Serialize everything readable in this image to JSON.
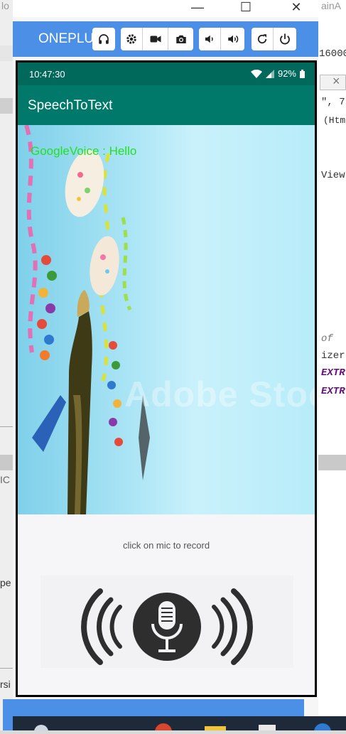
{
  "background": {
    "fragments": [
      "lo",
      "ainA",
      "16000",
      "\", 7",
      "(Htm",
      "View",
      "of ",
      "izer",
      "EXTR",
      "EXTR",
      "IC",
      "pe",
      "rsi"
    ]
  },
  "window": {
    "minimize_label": "—",
    "maximize_label": "☐",
    "close_label": "✕",
    "brand": "ONEPLUS A"
  },
  "toolbar": {
    "icons": [
      "headphones-icon",
      "settings-icon",
      "video-icon",
      "camera-icon",
      "volume-down-icon",
      "volume-up-icon",
      "rotate-icon",
      "power-icon"
    ]
  },
  "device": {
    "status": {
      "time": "10:47:30",
      "battery": "92%"
    },
    "app_title": "SpeechToText",
    "voice_result": "GoogleVoice : Hello",
    "watermark": "Adobe Stock",
    "hint": "click on mic to record",
    "colors": {
      "status_bar": "#00695c",
      "app_bar": "#00796b",
      "voice_text": "#22e022",
      "toolbar": "#4c8fe6"
    }
  }
}
